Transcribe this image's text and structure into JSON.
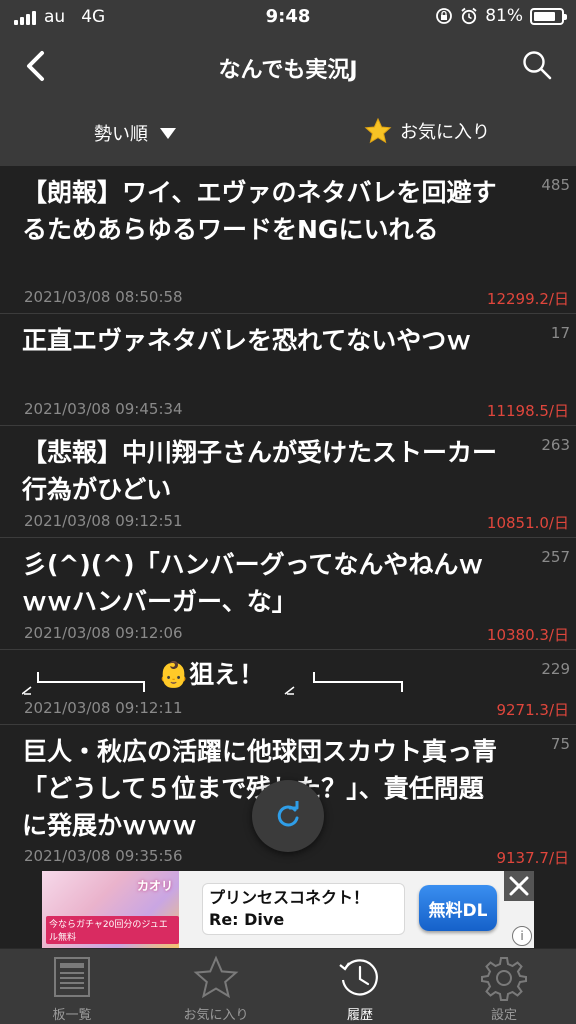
{
  "status_bar": {
    "carrier": "au",
    "network": "4G",
    "time": "9:48",
    "battery": "81%",
    "battery_level": 0.81
  },
  "nav": {
    "title": "なんでも実況J",
    "back_icon": "chevron-left-icon",
    "search_icon": "search-icon"
  },
  "filter": {
    "sort_label": "勢い順",
    "favorites_label": "お気に入り"
  },
  "threads": [
    {
      "title": "【朗報】ワイ、エヴァのネタバレを回避するためあらゆるワードをNGにいれる",
      "count": "485",
      "date": "2021/03/08 08:50:58",
      "speed": "12299.2/日"
    },
    {
      "title": "正直エヴァネタバレを恐れてないやつｗ",
      "count": "17",
      "date": "2021/03/08 09:45:34",
      "speed": "11198.5/日"
    },
    {
      "title": "【悲報】中川翔子さんが受けたストーカー行為がひどい",
      "count": "263",
      "date": "2021/03/08 09:12:51",
      "speed": "10851.0/日"
    },
    {
      "title": "彡(^)(^)「ハンバーグってなんやねんｗｗｗハンバーガー、な」",
      "count": "257",
      "date": "2021/03/08 09:12:06",
      "speed": "10380.3/日"
    },
    {
      "title": "👶狙え！",
      "count": "229",
      "date": "2021/03/08 09:12:11",
      "speed": "9271.3/日"
    },
    {
      "title": "巨人・秋広の活躍に他球団スカウト真っ青「どうして５位まで残した？」、責任問題に発展かｗｗｗ",
      "count": "75",
      "date": "2021/03/08 09:35:56",
      "speed": "9137.7/日"
    }
  ],
  "refresh_icon": "refresh-icon",
  "ad": {
    "text_line1": "プリンセスコネクト！",
    "text_line2": "Re: Dive",
    "cta": "無料DL",
    "image_logo": "カオリ",
    "image_badge": "今ならガチャ20回分のジュエル無料"
  },
  "tabs": [
    {
      "label": "板一覧",
      "icon": "board-list-icon"
    },
    {
      "label": "お気に入り",
      "icon": "star-icon"
    },
    {
      "label": "履歴",
      "icon": "history-clock-icon",
      "active": true
    },
    {
      "label": "設定",
      "icon": "gear-icon"
    }
  ]
}
